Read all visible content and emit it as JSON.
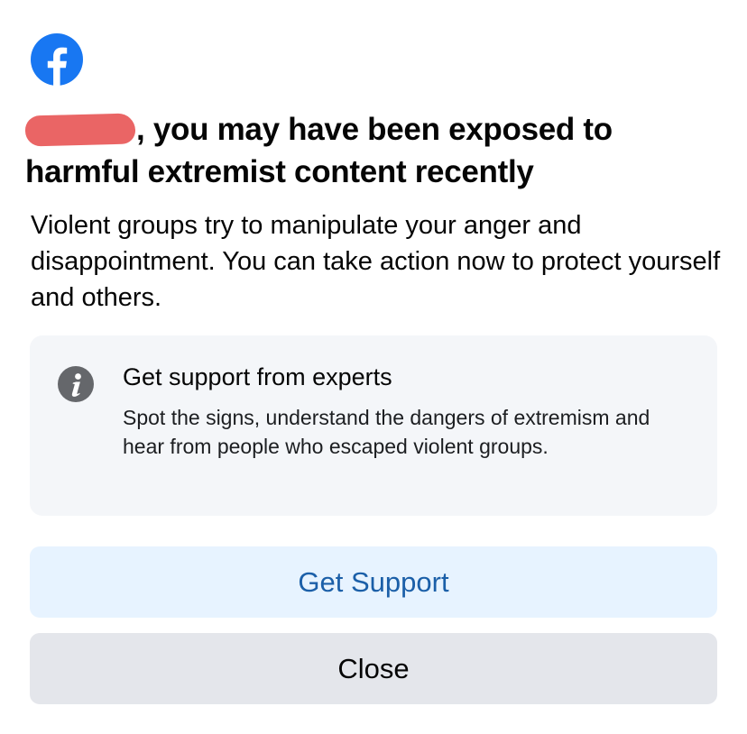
{
  "brand": {
    "logo_icon": "facebook-logo-icon",
    "brand_color": "#1877f2"
  },
  "dialog": {
    "headline": ", you may have been exposed to harmful extremist content recently",
    "body": "Violent groups try to manipulate your anger and disappointment. You can take action now to protect yourself and others."
  },
  "info_card": {
    "icon": "info-icon",
    "title": "Get support from experts",
    "description": "Spot the signs, understand the dangers of extremism and hear from people who escaped violent groups."
  },
  "actions": {
    "primary_label": "Get Support",
    "secondary_label": "Close"
  },
  "colors": {
    "primary_button_bg": "#e7f3ff",
    "primary_button_text": "#1b5fa8",
    "secondary_button_bg": "#e4e6eb",
    "card_bg": "#f4f6f9",
    "redaction": "#ea6565"
  }
}
